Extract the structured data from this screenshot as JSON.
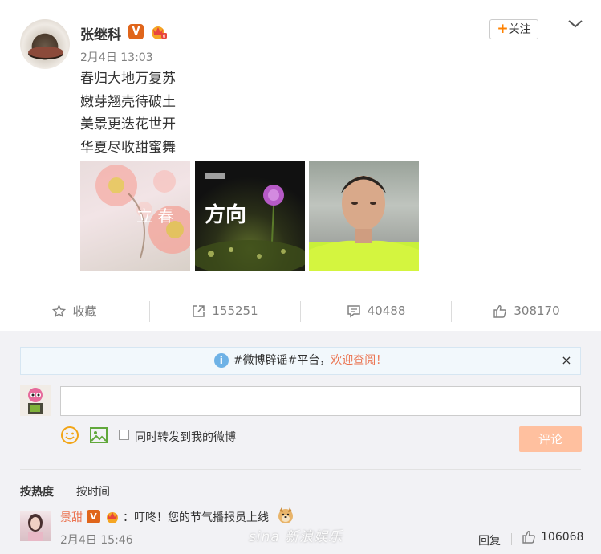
{
  "post": {
    "author": "张继科",
    "verified_badge": "V",
    "vip_icon": "vip-crown-icon",
    "timestamp": "2月4日 13:03",
    "follow_plus": "+",
    "follow_label": "关注",
    "more_icon": "chevron-down-icon",
    "lines": [
      "春归大地万复苏",
      "嫩芽翘壳待破土",
      "美景更迭花世开",
      "华夏尽收甜蜜舞"
    ],
    "images": [
      {
        "caption": "立 春",
        "scene": "pink blossoms"
      },
      {
        "caption": "方向",
        "scene": "purple flower at night"
      },
      {
        "scene": "man in neon green shirt selfie"
      }
    ]
  },
  "actions": {
    "favorite": {
      "label": "收藏",
      "icon": "star-icon"
    },
    "repost": {
      "count": "155251",
      "icon": "repost-icon"
    },
    "comment": {
      "count": "40488",
      "icon": "comment-icon"
    },
    "like": {
      "count": "308170",
      "icon": "thumbs-up-icon"
    }
  },
  "comment_box": {
    "notice_prefix": "#微博辟谣#平台，",
    "notice_link": "欢迎查阅！",
    "notice_close": "×",
    "input_value": "",
    "emoji_icon": "smiley-icon",
    "image_icon": "image-icon",
    "repost_checkbox_label": "同时转发到我的微博",
    "repost_checked": false,
    "submit_label": "评论"
  },
  "sort": {
    "hot": "按热度",
    "time": "按时间"
  },
  "comments": [
    {
      "user": "景甜",
      "verified_badge": "V",
      "text": "：叮咚！您的节气播报员上线",
      "emoji": "doge-icon",
      "time": "2月4日 15:46",
      "reply_label": "回复",
      "likes": "106068"
    }
  ],
  "watermark": "sina 新浪娱乐",
  "colors": {
    "accent_orange": "#ff8200",
    "link_orange": "#eb7350",
    "verified": "#e0651b",
    "submit_disabled": "#ffc09f",
    "comment_bg": "#f2f2f5"
  }
}
